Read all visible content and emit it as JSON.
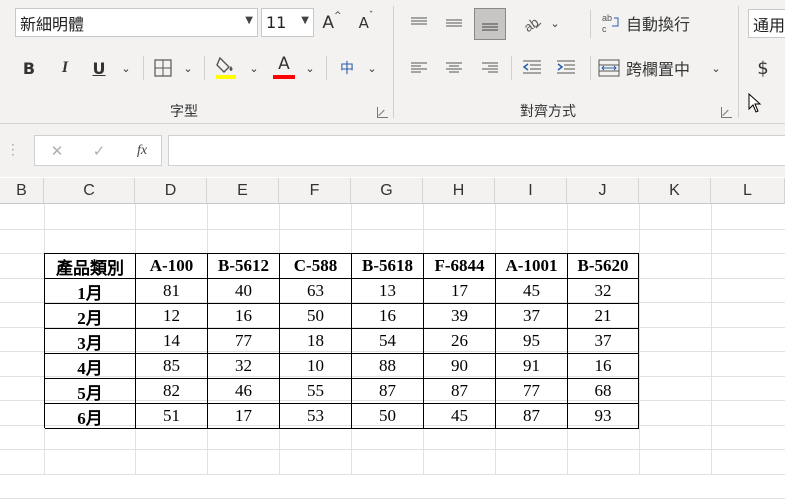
{
  "ribbon": {
    "font_name": "新細明體",
    "font_size": "11",
    "grow_font": "A",
    "shrink_font": "A",
    "bold": "B",
    "italic": "I",
    "underline": "U",
    "font_color_glyph": "A",
    "phonetic_glyph": "中",
    "font_group_label": "字型",
    "wrap_text": "自動換行",
    "merge_center": "跨欄置中",
    "align_group_label": "對齊方式",
    "number_format": "通用",
    "currency": "$",
    "fill_color": "#ffff00",
    "font_color": "#ff0000"
  },
  "formula_bar": {
    "cancel": "✕",
    "enter": "✓",
    "fx": "fx",
    "value": ""
  },
  "columns": [
    "B",
    "C",
    "D",
    "E",
    "F",
    "G",
    "H",
    "I",
    "J",
    "K",
    "L"
  ],
  "table": {
    "headers": [
      "產品類別",
      "A-100",
      "B-5612",
      "C-588",
      "B-5618",
      "F-6844",
      "A-1001",
      "B-5620"
    ],
    "rows": [
      {
        "label": "1月",
        "values": [
          "81",
          "40",
          "63",
          "13",
          "17",
          "45",
          "32"
        ]
      },
      {
        "label": "2月",
        "values": [
          "12",
          "16",
          "50",
          "16",
          "39",
          "37",
          "21"
        ]
      },
      {
        "label": "3月",
        "values": [
          "14",
          "77",
          "18",
          "54",
          "26",
          "95",
          "37"
        ]
      },
      {
        "label": "4月",
        "values": [
          "85",
          "32",
          "10",
          "88",
          "90",
          "91",
          "16"
        ]
      },
      {
        "label": "5月",
        "values": [
          "82",
          "46",
          "55",
          "87",
          "87",
          "77",
          "68"
        ]
      },
      {
        "label": "6月",
        "values": [
          "51",
          "17",
          "53",
          "50",
          "45",
          "87",
          "93"
        ]
      }
    ]
  }
}
